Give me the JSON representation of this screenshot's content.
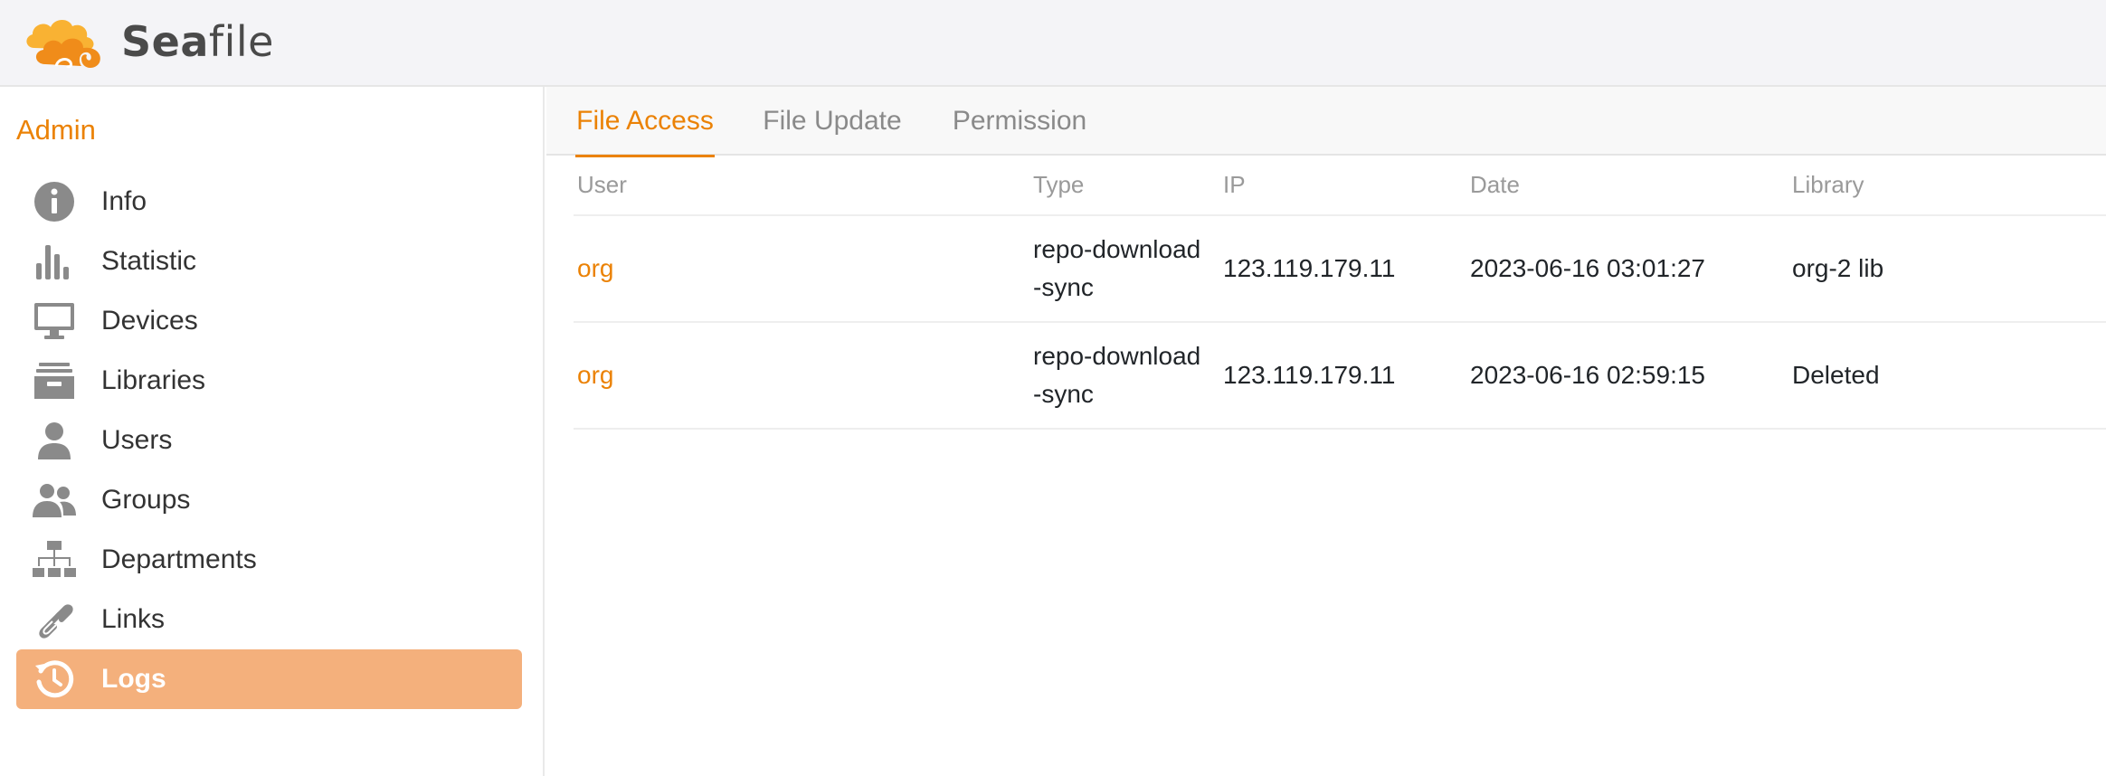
{
  "brand": {
    "name_bold": "Sea",
    "name_regular": "file",
    "accent_color": "#eb8205",
    "logo_icon": "seafile-cloud-logo"
  },
  "sidebar": {
    "heading": "Admin",
    "items": [
      {
        "label": "Info",
        "icon": "info-icon",
        "active": false
      },
      {
        "label": "Statistic",
        "icon": "bar-chart-icon",
        "active": false
      },
      {
        "label": "Devices",
        "icon": "monitor-icon",
        "active": false
      },
      {
        "label": "Libraries",
        "icon": "archive-icon",
        "active": false
      },
      {
        "label": "Users",
        "icon": "user-icon",
        "active": false
      },
      {
        "label": "Groups",
        "icon": "group-icon",
        "active": false
      },
      {
        "label": "Departments",
        "icon": "org-chart-icon",
        "active": false
      },
      {
        "label": "Links",
        "icon": "link-icon",
        "active": false
      },
      {
        "label": "Logs",
        "icon": "history-icon",
        "active": true
      }
    ],
    "active_color": "#f4b07c"
  },
  "tabs": [
    {
      "label": "File Access",
      "active": true
    },
    {
      "label": "File Update",
      "active": false
    },
    {
      "label": "Permission",
      "active": false
    }
  ],
  "table": {
    "columns": [
      "User",
      "Type",
      "IP",
      "Date",
      "Library"
    ],
    "rows": [
      {
        "user": "org",
        "type_line1": "repo-download",
        "type_line2": "-sync",
        "ip": "123.119.179.11",
        "date": "2023-06-16 03:01:27",
        "library": "org-2 lib"
      },
      {
        "user": "org",
        "type_line1": "repo-download",
        "type_line2": "-sync",
        "ip": "123.119.179.11",
        "date": "2023-06-16 02:59:15",
        "library": "Deleted"
      }
    ]
  }
}
